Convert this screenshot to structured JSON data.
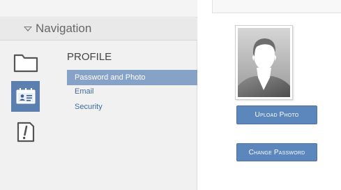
{
  "nav": {
    "title": "Navigation",
    "icons": {
      "folder": "folder-icon",
      "profile": "profile-card-icon",
      "alert": "alert-icon"
    },
    "section_title": "PROFILE",
    "items": [
      {
        "label": "Password and Photo",
        "selected": true
      },
      {
        "label": "Email",
        "selected": false
      },
      {
        "label": "Security",
        "selected": false
      }
    ]
  },
  "main": {
    "upload_label": "Upload Photo",
    "change_label": "Change Password"
  },
  "colors": {
    "active_icon_bg": "#5b7fae",
    "selected_item_bg": "#86a3c7",
    "button_bg": "#5c87bd",
    "link_text": "#3f6a9f"
  }
}
